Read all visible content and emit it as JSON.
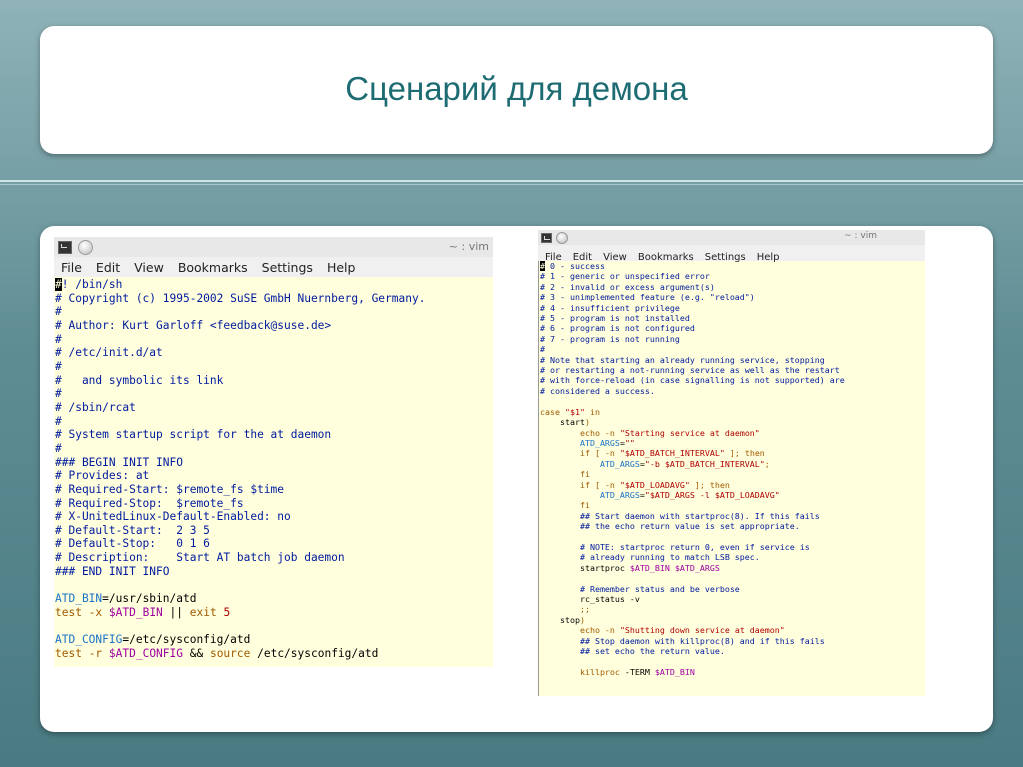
{
  "slide": {
    "title": "Сценарий для демона"
  },
  "left_window": {
    "title": "~ : vim",
    "menu": [
      "File",
      "Edit",
      "View",
      "Bookmarks",
      "Settings",
      "Help"
    ],
    "lines": [
      [
        {
          "t": "#",
          "c": "cursor"
        },
        {
          "t": "! /bin/sh",
          "c": "cm"
        }
      ],
      [
        {
          "t": "# Copyright (c) 1995-2002 SuSE GmbH Nuernberg, Germany.",
          "c": "cm"
        }
      ],
      [
        {
          "t": "#",
          "c": "cm"
        }
      ],
      [
        {
          "t": "# Author: Kurt Garloff <feedback@suse.de>",
          "c": "cm"
        }
      ],
      [
        {
          "t": "#",
          "c": "cm"
        }
      ],
      [
        {
          "t": "# /etc/init.d/at",
          "c": "cm"
        }
      ],
      [
        {
          "t": "#",
          "c": "cm"
        }
      ],
      [
        {
          "t": "#   and symbolic its link",
          "c": "cm"
        }
      ],
      [
        {
          "t": "#",
          "c": "cm"
        }
      ],
      [
        {
          "t": "# /sbin/rcat",
          "c": "cm"
        }
      ],
      [
        {
          "t": "#",
          "c": "cm"
        }
      ],
      [
        {
          "t": "# System startup script for the at daemon",
          "c": "cm"
        }
      ],
      [
        {
          "t": "#",
          "c": "cm"
        }
      ],
      [
        {
          "t": "### BEGIN INIT INFO",
          "c": "cm"
        }
      ],
      [
        {
          "t": "# Provides: at",
          "c": "cm"
        }
      ],
      [
        {
          "t": "# Required-Start: $remote_fs $time",
          "c": "cm"
        }
      ],
      [
        {
          "t": "# Required-Stop:  $remote_fs",
          "c": "cm"
        }
      ],
      [
        {
          "t": "# X-UnitedLinux-Default-Enabled: no",
          "c": "cm"
        }
      ],
      [
        {
          "t": "# Default-Start:  2 3 5",
          "c": "cm"
        }
      ],
      [
        {
          "t": "# Default-Stop:   0 1 6",
          "c": "cm"
        }
      ],
      [
        {
          "t": "# Description:    Start AT batch job daemon",
          "c": "cm"
        }
      ],
      [
        {
          "t": "### END INIT INFO",
          "c": "cm"
        }
      ],
      [
        {
          "t": "",
          "c": "op"
        }
      ],
      [
        {
          "t": "ATD_BIN",
          "c": "var"
        },
        {
          "t": "=/usr/sbin/atd",
          "c": "op"
        }
      ],
      [
        {
          "t": "test",
          "c": "cmd"
        },
        {
          "t": " -x ",
          "c": "cmd"
        },
        {
          "t": "$ATD_BIN",
          "c": "purple"
        },
        {
          "t": " || ",
          "c": "op"
        },
        {
          "t": "exit",
          "c": "cmd"
        },
        {
          "t": " 5",
          "c": "str"
        }
      ],
      [
        {
          "t": "",
          "c": "op"
        }
      ],
      [
        {
          "t": "ATD_CONFIG",
          "c": "var"
        },
        {
          "t": "=/etc/sysconfig/atd",
          "c": "op"
        }
      ],
      [
        {
          "t": "test",
          "c": "cmd"
        },
        {
          "t": " -r ",
          "c": "cmd"
        },
        {
          "t": "$ATD_CONFIG",
          "c": "purple"
        },
        {
          "t": " && ",
          "c": "op"
        },
        {
          "t": "source",
          "c": "cmd"
        },
        {
          "t": " /etc/sysconfig/atd",
          "c": "op"
        }
      ]
    ]
  },
  "right_window": {
    "title": "~ : vim",
    "menu": [
      "File",
      "Edit",
      "View",
      "Bookmarks",
      "Settings",
      "Help"
    ],
    "lines": [
      [
        {
          "t": "#",
          "c": "cursor"
        },
        {
          "t": " 0 - success",
          "c": "cm"
        }
      ],
      [
        {
          "t": "# 1 - generic or unspecified error",
          "c": "cm"
        }
      ],
      [
        {
          "t": "# 2 - invalid or excess argument(s)",
          "c": "cm"
        }
      ],
      [
        {
          "t": "# 3 - unimplemented feature (e.g. \"reload\")",
          "c": "cm"
        }
      ],
      [
        {
          "t": "# 4 - insufficient privilege",
          "c": "cm"
        }
      ],
      [
        {
          "t": "# 5 - program is not installed",
          "c": "cm"
        }
      ],
      [
        {
          "t": "# 6 - program is not configured",
          "c": "cm"
        }
      ],
      [
        {
          "t": "# 7 - program is not running",
          "c": "cm"
        }
      ],
      [
        {
          "t": "#",
          "c": "cm"
        }
      ],
      [
        {
          "t": "# Note that starting an already running service, stopping",
          "c": "cm"
        }
      ],
      [
        {
          "t": "# or restarting a not-running service as well as the restart",
          "c": "cm"
        }
      ],
      [
        {
          "t": "# with force-reload (in case signalling is not supported) are",
          "c": "cm"
        }
      ],
      [
        {
          "t": "# considered a success.",
          "c": "cm"
        }
      ],
      [
        {
          "t": "",
          "c": "op"
        }
      ],
      [
        {
          "t": "case",
          "c": "cmd"
        },
        {
          "t": " \"$1\"",
          "c": "str"
        },
        {
          "t": " in",
          "c": "cmd"
        }
      ],
      [
        {
          "t": "    start",
          "c": "op"
        },
        {
          "t": ")",
          "c": "cmd"
        }
      ],
      [
        {
          "t": "        echo -n ",
          "c": "cmd"
        },
        {
          "t": "\"Starting service at daemon\"",
          "c": "str"
        }
      ],
      [
        {
          "t": "        ATD_ARGS",
          "c": "var"
        },
        {
          "t": "=",
          "c": "op"
        },
        {
          "t": "\"\"",
          "c": "str"
        }
      ],
      [
        {
          "t": "        if",
          "c": "cmd"
        },
        {
          "t": " [ -n ",
          "c": "cmd"
        },
        {
          "t": "\"$ATD_BATCH_INTERVAL\"",
          "c": "str"
        },
        {
          "t": " ]; then",
          "c": "cmd"
        }
      ],
      [
        {
          "t": "            ATD_ARGS",
          "c": "var"
        },
        {
          "t": "=",
          "c": "op"
        },
        {
          "t": "\"-b $ATD_BATCH_INTERVAL\"",
          "c": "str"
        },
        {
          "t": ";",
          "c": "cmd"
        }
      ],
      [
        {
          "t": "        fi",
          "c": "cmd"
        }
      ],
      [
        {
          "t": "        if",
          "c": "cmd"
        },
        {
          "t": " [ -n ",
          "c": "cmd"
        },
        {
          "t": "\"$ATD_LOADAVG\"",
          "c": "str"
        },
        {
          "t": " ]; then",
          "c": "cmd"
        }
      ],
      [
        {
          "t": "            ATD_ARGS",
          "c": "var"
        },
        {
          "t": "=",
          "c": "op"
        },
        {
          "t": "\"$ATD_ARGS -l $ATD_LOADAVG\"",
          "c": "str"
        }
      ],
      [
        {
          "t": "        fi",
          "c": "cmd"
        }
      ],
      [
        {
          "t": "        ## Start daemon with startproc(8). If this fails",
          "c": "cm"
        }
      ],
      [
        {
          "t": "        ## the echo return value is set appropriate.",
          "c": "cm"
        }
      ],
      [
        {
          "t": "",
          "c": "op"
        }
      ],
      [
        {
          "t": "        # NOTE: startproc return 0, even if service is",
          "c": "cm"
        }
      ],
      [
        {
          "t": "        # already running to match LSB spec.",
          "c": "cm"
        }
      ],
      [
        {
          "t": "        startproc ",
          "c": "op"
        },
        {
          "t": "$ATD_BIN $ATD_ARGS",
          "c": "purple"
        }
      ],
      [
        {
          "t": "",
          "c": "op"
        }
      ],
      [
        {
          "t": "        # Remember status and be verbose",
          "c": "cm"
        }
      ],
      [
        {
          "t": "        rc_status -v",
          "c": "op"
        }
      ],
      [
        {
          "t": "        ;;",
          "c": "cmd"
        }
      ],
      [
        {
          "t": "    stop",
          "c": "op"
        },
        {
          "t": ")",
          "c": "cmd"
        }
      ],
      [
        {
          "t": "        echo -n ",
          "c": "cmd"
        },
        {
          "t": "\"Shutting down service at daemon\"",
          "c": "str"
        }
      ],
      [
        {
          "t": "        ## Stop daemon with killproc(8) and if this fails",
          "c": "cm"
        }
      ],
      [
        {
          "t": "        ## set echo the return value.",
          "c": "cm"
        }
      ],
      [
        {
          "t": "",
          "c": "op"
        }
      ],
      [
        {
          "t": "        killproc",
          "c": "cmd"
        },
        {
          "t": " -TERM ",
          "c": "op"
        },
        {
          "t": "$ATD_BIN",
          "c": "purple"
        }
      ]
    ]
  }
}
